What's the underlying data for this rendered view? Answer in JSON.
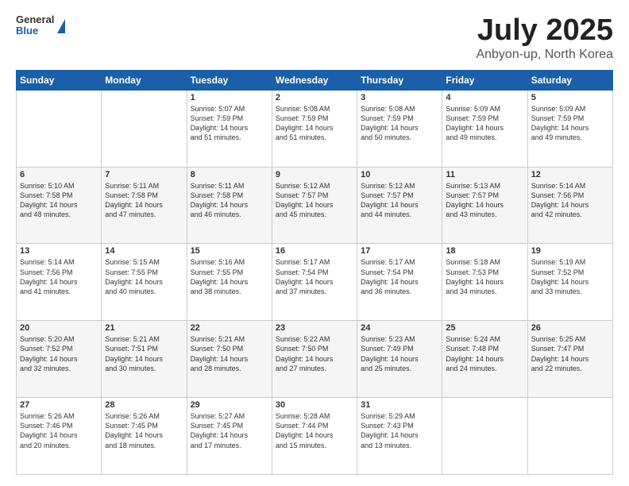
{
  "logo": {
    "general": "General",
    "blue": "Blue"
  },
  "title": "July 2025",
  "subtitle": "Anbyon-up, North Korea",
  "days_of_week": [
    "Sunday",
    "Monday",
    "Tuesday",
    "Wednesday",
    "Thursday",
    "Friday",
    "Saturday"
  ],
  "weeks": [
    [
      {
        "day": "",
        "info": ""
      },
      {
        "day": "",
        "info": ""
      },
      {
        "day": "1",
        "info": "Sunrise: 5:07 AM\nSunset: 7:59 PM\nDaylight: 14 hours\nand 51 minutes."
      },
      {
        "day": "2",
        "info": "Sunrise: 5:08 AM\nSunset: 7:59 PM\nDaylight: 14 hours\nand 51 minutes."
      },
      {
        "day": "3",
        "info": "Sunrise: 5:08 AM\nSunset: 7:59 PM\nDaylight: 14 hours\nand 50 minutes."
      },
      {
        "day": "4",
        "info": "Sunrise: 5:09 AM\nSunset: 7:59 PM\nDaylight: 14 hours\nand 49 minutes."
      },
      {
        "day": "5",
        "info": "Sunrise: 5:09 AM\nSunset: 7:59 PM\nDaylight: 14 hours\nand 49 minutes."
      }
    ],
    [
      {
        "day": "6",
        "info": "Sunrise: 5:10 AM\nSunset: 7:58 PM\nDaylight: 14 hours\nand 48 minutes."
      },
      {
        "day": "7",
        "info": "Sunrise: 5:11 AM\nSunset: 7:58 PM\nDaylight: 14 hours\nand 47 minutes."
      },
      {
        "day": "8",
        "info": "Sunrise: 5:11 AM\nSunset: 7:58 PM\nDaylight: 14 hours\nand 46 minutes."
      },
      {
        "day": "9",
        "info": "Sunrise: 5:12 AM\nSunset: 7:57 PM\nDaylight: 14 hours\nand 45 minutes."
      },
      {
        "day": "10",
        "info": "Sunrise: 5:12 AM\nSunset: 7:57 PM\nDaylight: 14 hours\nand 44 minutes."
      },
      {
        "day": "11",
        "info": "Sunrise: 5:13 AM\nSunset: 7:57 PM\nDaylight: 14 hours\nand 43 minutes."
      },
      {
        "day": "12",
        "info": "Sunrise: 5:14 AM\nSunset: 7:56 PM\nDaylight: 14 hours\nand 42 minutes."
      }
    ],
    [
      {
        "day": "13",
        "info": "Sunrise: 5:14 AM\nSunset: 7:56 PM\nDaylight: 14 hours\nand 41 minutes."
      },
      {
        "day": "14",
        "info": "Sunrise: 5:15 AM\nSunset: 7:55 PM\nDaylight: 14 hours\nand 40 minutes."
      },
      {
        "day": "15",
        "info": "Sunrise: 5:16 AM\nSunset: 7:55 PM\nDaylight: 14 hours\nand 38 minutes."
      },
      {
        "day": "16",
        "info": "Sunrise: 5:17 AM\nSunset: 7:54 PM\nDaylight: 14 hours\nand 37 minutes."
      },
      {
        "day": "17",
        "info": "Sunrise: 5:17 AM\nSunset: 7:54 PM\nDaylight: 14 hours\nand 36 minutes."
      },
      {
        "day": "18",
        "info": "Sunrise: 5:18 AM\nSunset: 7:53 PM\nDaylight: 14 hours\nand 34 minutes."
      },
      {
        "day": "19",
        "info": "Sunrise: 5:19 AM\nSunset: 7:52 PM\nDaylight: 14 hours\nand 33 minutes."
      }
    ],
    [
      {
        "day": "20",
        "info": "Sunrise: 5:20 AM\nSunset: 7:52 PM\nDaylight: 14 hours\nand 32 minutes."
      },
      {
        "day": "21",
        "info": "Sunrise: 5:21 AM\nSunset: 7:51 PM\nDaylight: 14 hours\nand 30 minutes."
      },
      {
        "day": "22",
        "info": "Sunrise: 5:21 AM\nSunset: 7:50 PM\nDaylight: 14 hours\nand 28 minutes."
      },
      {
        "day": "23",
        "info": "Sunrise: 5:22 AM\nSunset: 7:50 PM\nDaylight: 14 hours\nand 27 minutes."
      },
      {
        "day": "24",
        "info": "Sunrise: 5:23 AM\nSunset: 7:49 PM\nDaylight: 14 hours\nand 25 minutes."
      },
      {
        "day": "25",
        "info": "Sunrise: 5:24 AM\nSunset: 7:48 PM\nDaylight: 14 hours\nand 24 minutes."
      },
      {
        "day": "26",
        "info": "Sunrise: 5:25 AM\nSunset: 7:47 PM\nDaylight: 14 hours\nand 22 minutes."
      }
    ],
    [
      {
        "day": "27",
        "info": "Sunrise: 5:26 AM\nSunset: 7:46 PM\nDaylight: 14 hours\nand 20 minutes."
      },
      {
        "day": "28",
        "info": "Sunrise: 5:26 AM\nSunset: 7:45 PM\nDaylight: 14 hours\nand 18 minutes."
      },
      {
        "day": "29",
        "info": "Sunrise: 5:27 AM\nSunset: 7:45 PM\nDaylight: 14 hours\nand 17 minutes."
      },
      {
        "day": "30",
        "info": "Sunrise: 5:28 AM\nSunset: 7:44 PM\nDaylight: 14 hours\nand 15 minutes."
      },
      {
        "day": "31",
        "info": "Sunrise: 5:29 AM\nSunset: 7:43 PM\nDaylight: 14 hours\nand 13 minutes."
      },
      {
        "day": "",
        "info": ""
      },
      {
        "day": "",
        "info": ""
      }
    ]
  ]
}
